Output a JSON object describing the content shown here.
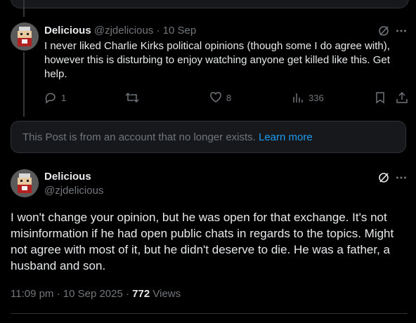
{
  "reply": {
    "name": "Delicious",
    "handle": "@zjdelicious",
    "sep": "·",
    "date": "10 Sep",
    "text": "I never liked Charlie Kirks political opinions (though some I do agree with), however this is disturbing to enjoy watching anyone get killed like this. Get help.",
    "replies": "1",
    "likes": "8",
    "views": "336"
  },
  "notice": {
    "text": "This Post is from an account that no longer exists.",
    "link": "Learn more"
  },
  "post": {
    "name": "Delicious",
    "handle": "@zjdelicious",
    "text": "I won't change your opinion, but he was open for that exchange. It's not misinformation if he had open public chats in regards to the topics. Might not agree with most of it, but he didn't deserve to die. He was a father, a husband and son.",
    "time": "11:09 pm · 10 Sep 2025 ·",
    "views_count": "772",
    "views_label": "Views"
  },
  "colors": {
    "accent": "#1d9bf0",
    "muted": "#71767b",
    "text": "#e7e9ea",
    "border": "#2f3336"
  },
  "icons": [
    "grok-icon",
    "more-icon",
    "reply-icon",
    "retweet-icon",
    "like-icon",
    "views-icon",
    "bookmark-icon",
    "share-icon"
  ]
}
